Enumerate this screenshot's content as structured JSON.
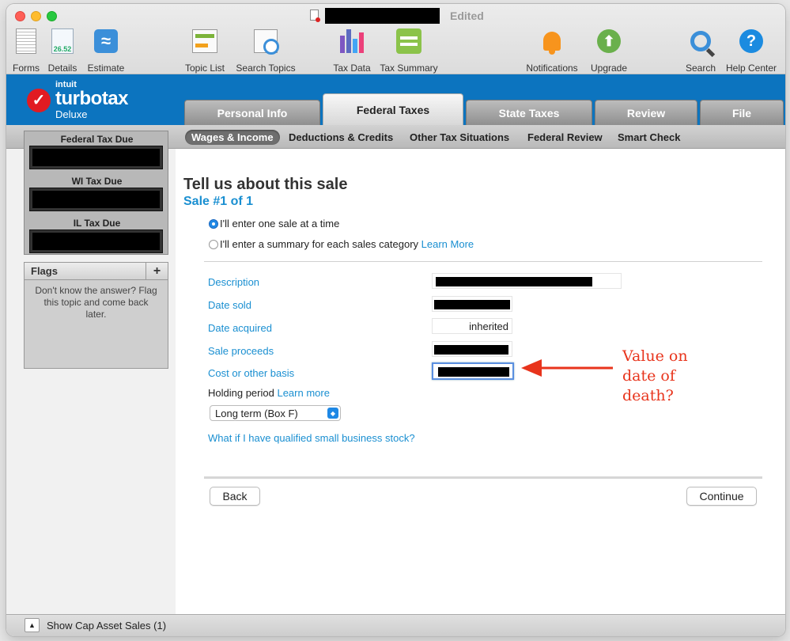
{
  "window": {
    "title_status": "Edited"
  },
  "toolbar": {
    "items": [
      {
        "label": "Forms",
        "icon": "forms-icon"
      },
      {
        "label": "Details",
        "icon": "details-icon",
        "badge": "26.52"
      },
      {
        "label": "Estimate",
        "icon": "estimate-icon",
        "glyph": "≈"
      },
      {
        "label": "Topic List",
        "icon": "topic-list-icon"
      },
      {
        "label": "Search Topics",
        "icon": "search-topics-icon"
      },
      {
        "label": "Tax Data",
        "icon": "tax-data-icon"
      },
      {
        "label": "Tax Summary",
        "icon": "tax-summary-icon"
      },
      {
        "label": "Notifications",
        "icon": "bell-icon"
      },
      {
        "label": "Upgrade",
        "icon": "upgrade-arrow-icon",
        "glyph": "⬆"
      },
      {
        "label": "Search",
        "icon": "magnifier-icon"
      },
      {
        "label": "Help Center",
        "icon": "help-icon",
        "glyph": "?"
      }
    ]
  },
  "brand": {
    "check": "✓",
    "intuit": "intuit",
    "name": "turbotax",
    "edition": "Deluxe",
    "color": "#0c74bf"
  },
  "tabs": [
    "Personal Info",
    "Federal Taxes",
    "State Taxes",
    "Review",
    "File"
  ],
  "subtabs": [
    "Wages & Income",
    "Deductions & Credits",
    "Other Tax Situations",
    "Federal Review",
    "Smart Check"
  ],
  "sidebar": {
    "tax_due": [
      "Federal Tax Due",
      "WI Tax Due",
      "IL Tax Due"
    ],
    "flags": {
      "title": "Flags",
      "add": "+",
      "text": "Don't know the answer? Flag this topic and come back later."
    }
  },
  "main": {
    "title": "Tell us about this sale",
    "subtitle": "Sale #1 of 1",
    "options": [
      {
        "label": "I'll enter one sale at a time",
        "selected": true
      },
      {
        "label": "I'll enter a summary for each sales category",
        "link": "Learn More",
        "selected": false
      }
    ],
    "fields": [
      {
        "label": "Description",
        "value": ""
      },
      {
        "label": "Date sold",
        "value": ""
      },
      {
        "label": "Date acquired",
        "value": "inherited"
      },
      {
        "label": "Sale proceeds",
        "value": ""
      },
      {
        "label": "Cost or other basis",
        "value": ""
      }
    ],
    "holding_period": {
      "label": "Holding period",
      "link": "Learn more",
      "selected": "Long term (Box F)"
    },
    "qsbs_link": "What if I have qualified small business stock?",
    "back": "Back",
    "continue": "Continue"
  },
  "annotation": {
    "lines": [
      "Value on",
      "date of",
      "death?"
    ],
    "color": "#e8341c"
  },
  "statusbar": {
    "toggle": "▲",
    "text": "Show Cap Asset Sales (1)"
  }
}
